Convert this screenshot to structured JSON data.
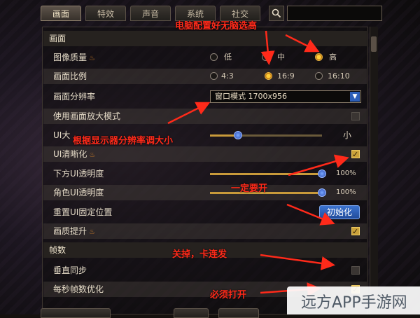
{
  "tabs": [
    {
      "label": "画面"
    },
    {
      "label": "特效"
    },
    {
      "label": "声音"
    },
    {
      "label": "系统"
    },
    {
      "label": "社交"
    }
  ],
  "sections": {
    "display": "画面",
    "fps": "帧数"
  },
  "rows": {
    "image_quality": {
      "label": "图像质量",
      "options": [
        "低",
        "中",
        "高"
      ],
      "selected": "高"
    },
    "aspect_ratio": {
      "label": "画面比例",
      "options": [
        "4:3",
        "16:9",
        "16:10"
      ],
      "selected": "16:9"
    },
    "resolution": {
      "label": "画面分辨率",
      "value": "窗口模式 1700x956"
    },
    "zoom_mode": {
      "label": "使用画面放大模式",
      "checked": false
    },
    "ui_size": {
      "label": "UI大",
      "value_text": "小",
      "level": 0.25
    },
    "ui_sharpen": {
      "label": "UI清晰化",
      "checked": true
    },
    "bottom_ui_opacity": {
      "label": "下方UI透明度",
      "value": "100%",
      "level": 1.0
    },
    "role_ui_opacity": {
      "label": "角色UI透明度",
      "value": "100%",
      "level": 1.0
    },
    "reset_ui": {
      "label": "重置UI固定位置",
      "button": "初始化"
    },
    "quality_boost": {
      "label": "画质提升",
      "checked": true
    },
    "vsync": {
      "label": "垂直同步",
      "checked": false
    },
    "fps_opt": {
      "label": "每秒帧数优化",
      "checked": true
    }
  },
  "annotations": {
    "a1": "电脑配置好无脑选高",
    "a2": "根据显示器分辨率调大小",
    "a3": "一定要开",
    "a4": "关掉，卡连发",
    "a5": "必须打开"
  },
  "watermark": "远方APP手游网",
  "colors": {
    "annotation": "#ff2a1a",
    "accent_blue": "#2d5fb8",
    "check_gold": "#caa23a"
  }
}
